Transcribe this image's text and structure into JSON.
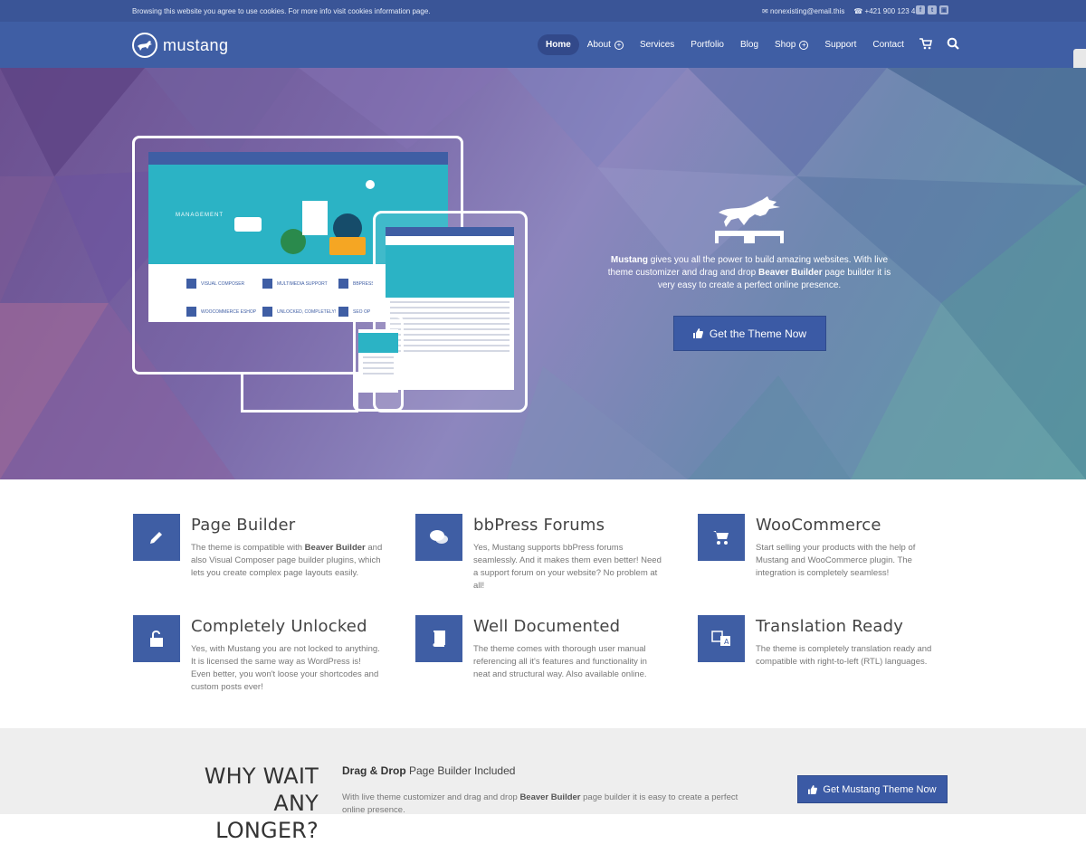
{
  "topbar": {
    "cookie_text": "Browsing this website you agree to use cookies. For more info visit cookies information page.",
    "email": "nonexisting@email.this",
    "phone": "+421 900 123 456",
    "social_icons": [
      "facebook-icon",
      "twitter-icon",
      "instagram-icon"
    ]
  },
  "header": {
    "logo_text": "mustang",
    "nav": [
      {
        "label": "Home",
        "active": true
      },
      {
        "label": "About",
        "has_submenu": true
      },
      {
        "label": "Services"
      },
      {
        "label": "Portfolio"
      },
      {
        "label": "Blog"
      },
      {
        "label": "Shop",
        "has_submenu": true
      },
      {
        "label": "Support"
      },
      {
        "label": "Contact"
      }
    ],
    "icons": [
      "cart-icon",
      "search-icon"
    ]
  },
  "hero": {
    "tagline_brand": "Mustang",
    "tagline_part1": " gives you all the power to build amazing websites. With live theme customizer and drag and drop ",
    "tagline_builder": "Beaver Builder",
    "tagline_part2": " page builder it is very easy to create a perfect online presence.",
    "cta_label": "Get the Theme Now",
    "mock_screen_label": "MANAGEMENT",
    "mock_features": [
      "VISUAL COMPOSER",
      "MULTIMEDIA SUPPORT",
      "BBPRESS",
      "WOOCOMMERCE ESHOP",
      "UNLOCKED, COMPLETELY!",
      "SEO OP"
    ]
  },
  "features": [
    {
      "title": "Page Builder",
      "icon": "pencil-icon",
      "text_before": "The theme is compatible with ",
      "bold": "Beaver Builder",
      "text_after": " and also Visual Composer page builder plugins, which lets you create complex page layouts easily."
    },
    {
      "title": "bbPress Forums",
      "icon": "chat-bubbles-icon",
      "text_before": "Yes, Mustang supports bbPress forums seamlessly. And it makes them even better! Need a support forum on your website? No problem at all!",
      "bold": "",
      "text_after": ""
    },
    {
      "title": "WooCommerce",
      "icon": "cart-icon",
      "text_before": "Start selling your products with the help of Mustang and WooCommerce plugin. The integration is completely seamless!",
      "bold": "",
      "text_after": ""
    },
    {
      "title": "Completely Unlocked",
      "icon": "unlock-icon",
      "text_before": "Yes, with Mustang you are not locked to anything. It is licensed the same way as WordPress is! Even better, you won't loose your shortcodes and custom posts ever!",
      "bold": "",
      "text_after": ""
    },
    {
      "title": "Well Documented",
      "icon": "book-icon",
      "text_before": "The theme comes with thorough user manual referencing all it's features and functionality in neat and structural way. Also available online.",
      "bold": "",
      "text_after": ""
    },
    {
      "title": "Translation Ready",
      "icon": "translate-icon",
      "text_before": "The theme is completely translation ready and compatible with right-to-left (RTL) languages.",
      "bold": "",
      "text_after": ""
    }
  ],
  "bottom": {
    "why_line1": "WHY WAIT ANY",
    "why_line2": "LONGER?",
    "dd_bold": "Drag & Drop",
    "dd_rest": " Page Builder Included",
    "text_before": "With live theme customizer and drag and drop ",
    "text_bold": "Beaver Builder",
    "text_after": " page builder it is easy to create a perfect online presence.",
    "cta_label": "Get Mustang Theme Now"
  },
  "colors": {
    "brand_blue": "#3f5ea4",
    "topbar_blue": "#3a5597",
    "teal": "#2bb3c5",
    "bottom_band": "#eeeeee"
  }
}
